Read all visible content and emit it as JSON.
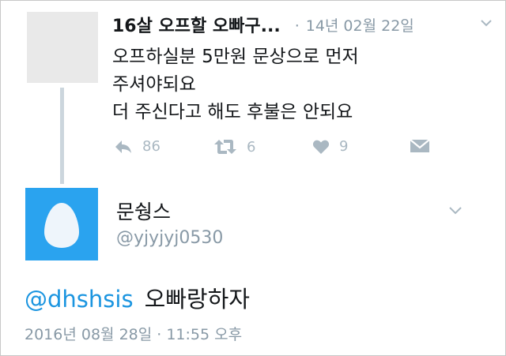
{
  "parent_tweet": {
    "display_name": "16살 오프할 오빠구...",
    "date": "14년 02월 22일",
    "separator": "·",
    "lines": [
      "오프하실분 5만원 문상으로 먼저",
      "주셔야되요",
      "더 주신다고 해도 후불은 안되요"
    ],
    "actions": {
      "reply_count": "86",
      "retweet_count": "6",
      "like_count": "9"
    }
  },
  "reply_tweet": {
    "display_name": "문쉉스",
    "handle": "@yjyjyj0530",
    "mention": "@dhshsis",
    "body": "오빠랑하자",
    "timestamp": "2016년 08월 28일 · 11:55 오후"
  },
  "colors": {
    "avatar_blue": "#2aa3ef",
    "mention_blue": "#1b95e0",
    "muted_gray": "#8899a6",
    "icon_gray": "#aab8c2",
    "thread_line": "#ccd6dd"
  }
}
